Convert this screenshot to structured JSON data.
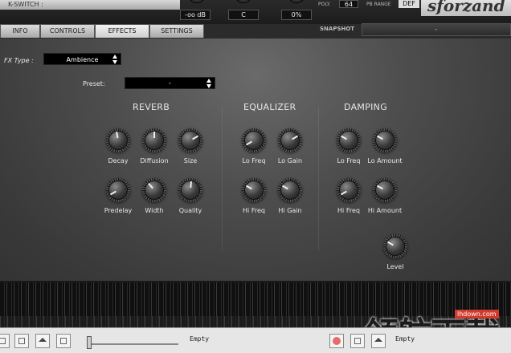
{
  "top": {
    "kswitch_label": "K-SWITCH :",
    "volume_value": "-oo dB",
    "key_value": "C",
    "pan_value": "0%",
    "poly_label": "POLY.",
    "poly_value": "64",
    "pb_range_label": "PB RANGE",
    "pb_range_value": "DEF",
    "brand": "sforzand"
  },
  "tabs": [
    {
      "label": "INFO",
      "active": false
    },
    {
      "label": "CONTROLS",
      "active": false
    },
    {
      "label": "EFFECTS",
      "active": true
    },
    {
      "label": "SETTINGS",
      "active": false
    }
  ],
  "snapshot": {
    "label": "SNAPSHOT",
    "value": "-"
  },
  "fx": {
    "type_label": "FX Type :",
    "type_value": "Ambience",
    "preset_label": "Preset:",
    "preset_value": "-"
  },
  "sections": {
    "reverb": "REVERB",
    "equalizer": "EQUALIZER",
    "damping": "DAMPING"
  },
  "knobs": {
    "decay": "Decay",
    "diffusion": "Diffusion",
    "size": "Size",
    "predelay": "Predelay",
    "width": "Width",
    "quality": "Quality",
    "eq_lo_freq": "Lo Freq",
    "eq_lo_gain": "Lo Gain",
    "eq_hi_freq": "Hi Freq",
    "eq_hi_gain": "Hi Gain",
    "dmp_lo_freq": "Lo Freq",
    "dmp_lo_amount": "Lo Amount",
    "dmp_hi_freq": "Hi Freq",
    "dmp_hi_amount": "Hi Amount",
    "level": "Level"
  },
  "transport": {
    "left_file": "Empty",
    "right_file": "Empty"
  },
  "watermark": {
    "site": "lhdown.com",
    "cn": "领航下载"
  }
}
